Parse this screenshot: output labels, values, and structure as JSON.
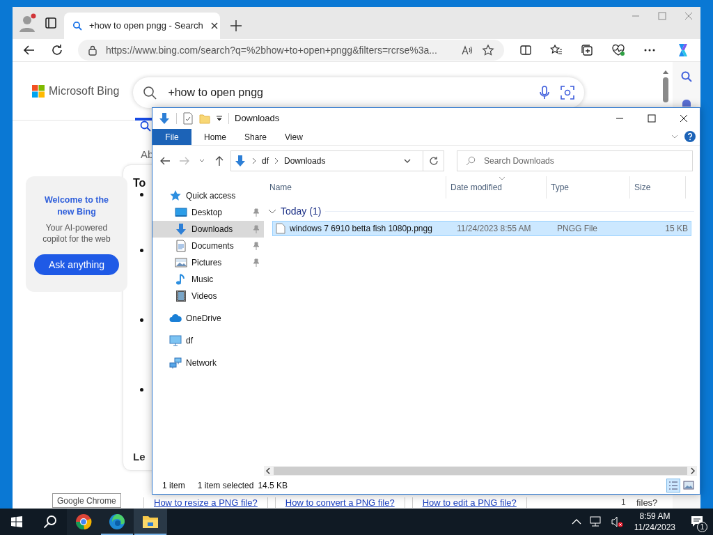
{
  "browser": {
    "tab": {
      "title": "+how to open pngg - Search"
    },
    "url": "https://www.bing.com/search?q=%2bhow+to+open+pngg&filters=rcrse%3a..."
  },
  "bing": {
    "logo": "Microsoft Bing",
    "query": "+how to open pngg",
    "partial_texts": [
      "Ab",
      "To",
      "Le"
    ],
    "promo": {
      "title": "Welcome to the new Bing",
      "subtitle": "Your AI-powered copilot for the web",
      "button": "Ask anything"
    },
    "related": [
      "How to resize a PNG file?",
      "How to convert a PNG file?",
      "How to edit a PNG file?"
    ],
    "related_count": "1",
    "related_tail": "files?"
  },
  "explorer": {
    "title": "Downloads",
    "ribbon_tabs": [
      {
        "label": "File",
        "selected": true
      },
      {
        "label": "Home",
        "selected": false
      },
      {
        "label": "Share",
        "selected": false
      },
      {
        "label": "View",
        "selected": false
      }
    ],
    "breadcrumb": [
      "df",
      "Downloads"
    ],
    "search_placeholder": "Search Downloads",
    "nav": [
      {
        "label": "Quick access",
        "kind": "star",
        "selected": false,
        "children": [
          {
            "label": "Desktop",
            "kind": "desktop",
            "pinned": true,
            "selected": false
          },
          {
            "label": "Downloads",
            "kind": "download",
            "pinned": true,
            "selected": true
          },
          {
            "label": "Documents",
            "kind": "document",
            "pinned": true,
            "selected": false
          },
          {
            "label": "Pictures",
            "kind": "pictures",
            "pinned": true,
            "selected": false
          },
          {
            "label": "Music",
            "kind": "music",
            "pinned": false,
            "selected": false
          },
          {
            "label": "Videos",
            "kind": "videos",
            "pinned": false,
            "selected": false
          }
        ]
      },
      {
        "label": "OneDrive",
        "kind": "cloud",
        "selected": false
      },
      {
        "label": "df",
        "kind": "computer",
        "selected": false
      },
      {
        "label": "Network",
        "kind": "network",
        "selected": false
      }
    ],
    "columns": [
      "Name",
      "Date modified",
      "Type",
      "Size"
    ],
    "group": "Today (1)",
    "files": [
      {
        "name": "windows 7 6910 betta fish 1080p.pngg",
        "date": "11/24/2023 8:55 AM",
        "type": "PNGG File",
        "size": "15 KB",
        "selected": true
      }
    ],
    "status": [
      "1 item",
      "1 item selected",
      "14.5 KB"
    ]
  },
  "tooltip": "Google Chrome",
  "taskbar": {
    "apps": [
      {
        "kind": "chrome",
        "running": false,
        "selected": false
      },
      {
        "kind": "edge",
        "running": true,
        "selected": false
      },
      {
        "kind": "explorer",
        "running": true,
        "selected": true
      }
    ],
    "time": "8:59 AM",
    "date": "11/24/2023",
    "notifications": "1"
  }
}
